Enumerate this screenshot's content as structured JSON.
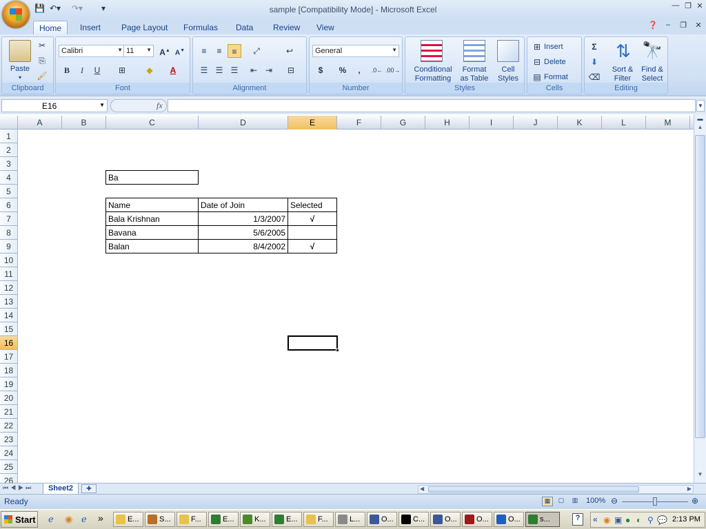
{
  "window": {
    "title": "sample  [Compatibility Mode] - Microsoft Excel",
    "minimize_icon": "minimize-icon",
    "restore_icon": "restore-icon",
    "close_icon": "close-icon"
  },
  "tabs": [
    "Home",
    "Insert",
    "Page Layout",
    "Formulas",
    "Data",
    "Review",
    "View"
  ],
  "active_tab": "Home",
  "ribbon": {
    "clipboard": {
      "label": "Clipboard",
      "paste": "Paste"
    },
    "font": {
      "label": "Font",
      "family": "Calibri",
      "size": "11",
      "bold": "B",
      "italic": "I",
      "underline": "U"
    },
    "alignment": {
      "label": "Alignment"
    },
    "number": {
      "label": "Number",
      "format": "General",
      "currency": "$",
      "percent": "%",
      "comma": ","
    },
    "styles": {
      "label": "Styles",
      "conditional_1": "Conditional",
      "conditional_2": "Formatting",
      "table_1": "Format",
      "table_2": "as Table",
      "cell_1": "Cell",
      "cell_2": "Styles"
    },
    "cells": {
      "label": "Cells",
      "insert": "Insert",
      "delete": "Delete",
      "format": "Format"
    },
    "editing": {
      "label": "Editing",
      "sort_1": "Sort &",
      "sort_2": "Filter",
      "find_1": "Find &",
      "find_2": "Select",
      "sigma": "Σ"
    }
  },
  "formula_bar": {
    "name_box": "E16",
    "fx": "fx",
    "formula": ""
  },
  "columns": [
    "A",
    "B",
    "C",
    "D",
    "E",
    "F",
    "G",
    "H",
    "I",
    "J",
    "K",
    "L",
    "M"
  ],
  "selected_column": "E",
  "rows": [
    "1",
    "2",
    "3",
    "4",
    "5",
    "6",
    "7",
    "8",
    "9",
    "10",
    "11",
    "12",
    "13",
    "14",
    "15",
    "16",
    "17",
    "18",
    "19",
    "20",
    "21",
    "22",
    "23",
    "24",
    "25",
    "26"
  ],
  "selected_row": "16",
  "cells": {
    "C4": "Ba",
    "header": {
      "name": "Name",
      "date": "Date of Join",
      "selected": "Selected"
    },
    "data": [
      {
        "name": "Bala Krishnan",
        "date": "1/3/2007",
        "selected": "√"
      },
      {
        "name": "Bavana",
        "date": "5/6/2005",
        "selected": ""
      },
      {
        "name": "Balan",
        "date": "8/4/2002",
        "selected": "√"
      }
    ]
  },
  "sheet_tab": "Sheet2",
  "status": {
    "ready": "Ready",
    "zoom": "100%"
  },
  "taskbar": {
    "start": "Start",
    "chevron": "»",
    "items": [
      "E...",
      "S...",
      "F...",
      "E...",
      "K...",
      "E...",
      "F...",
      "L...",
      "O...",
      "C...",
      "O...",
      "O...",
      "O...",
      "s..."
    ],
    "clock": "2:13 PM",
    "tray_chevron": "«"
  }
}
